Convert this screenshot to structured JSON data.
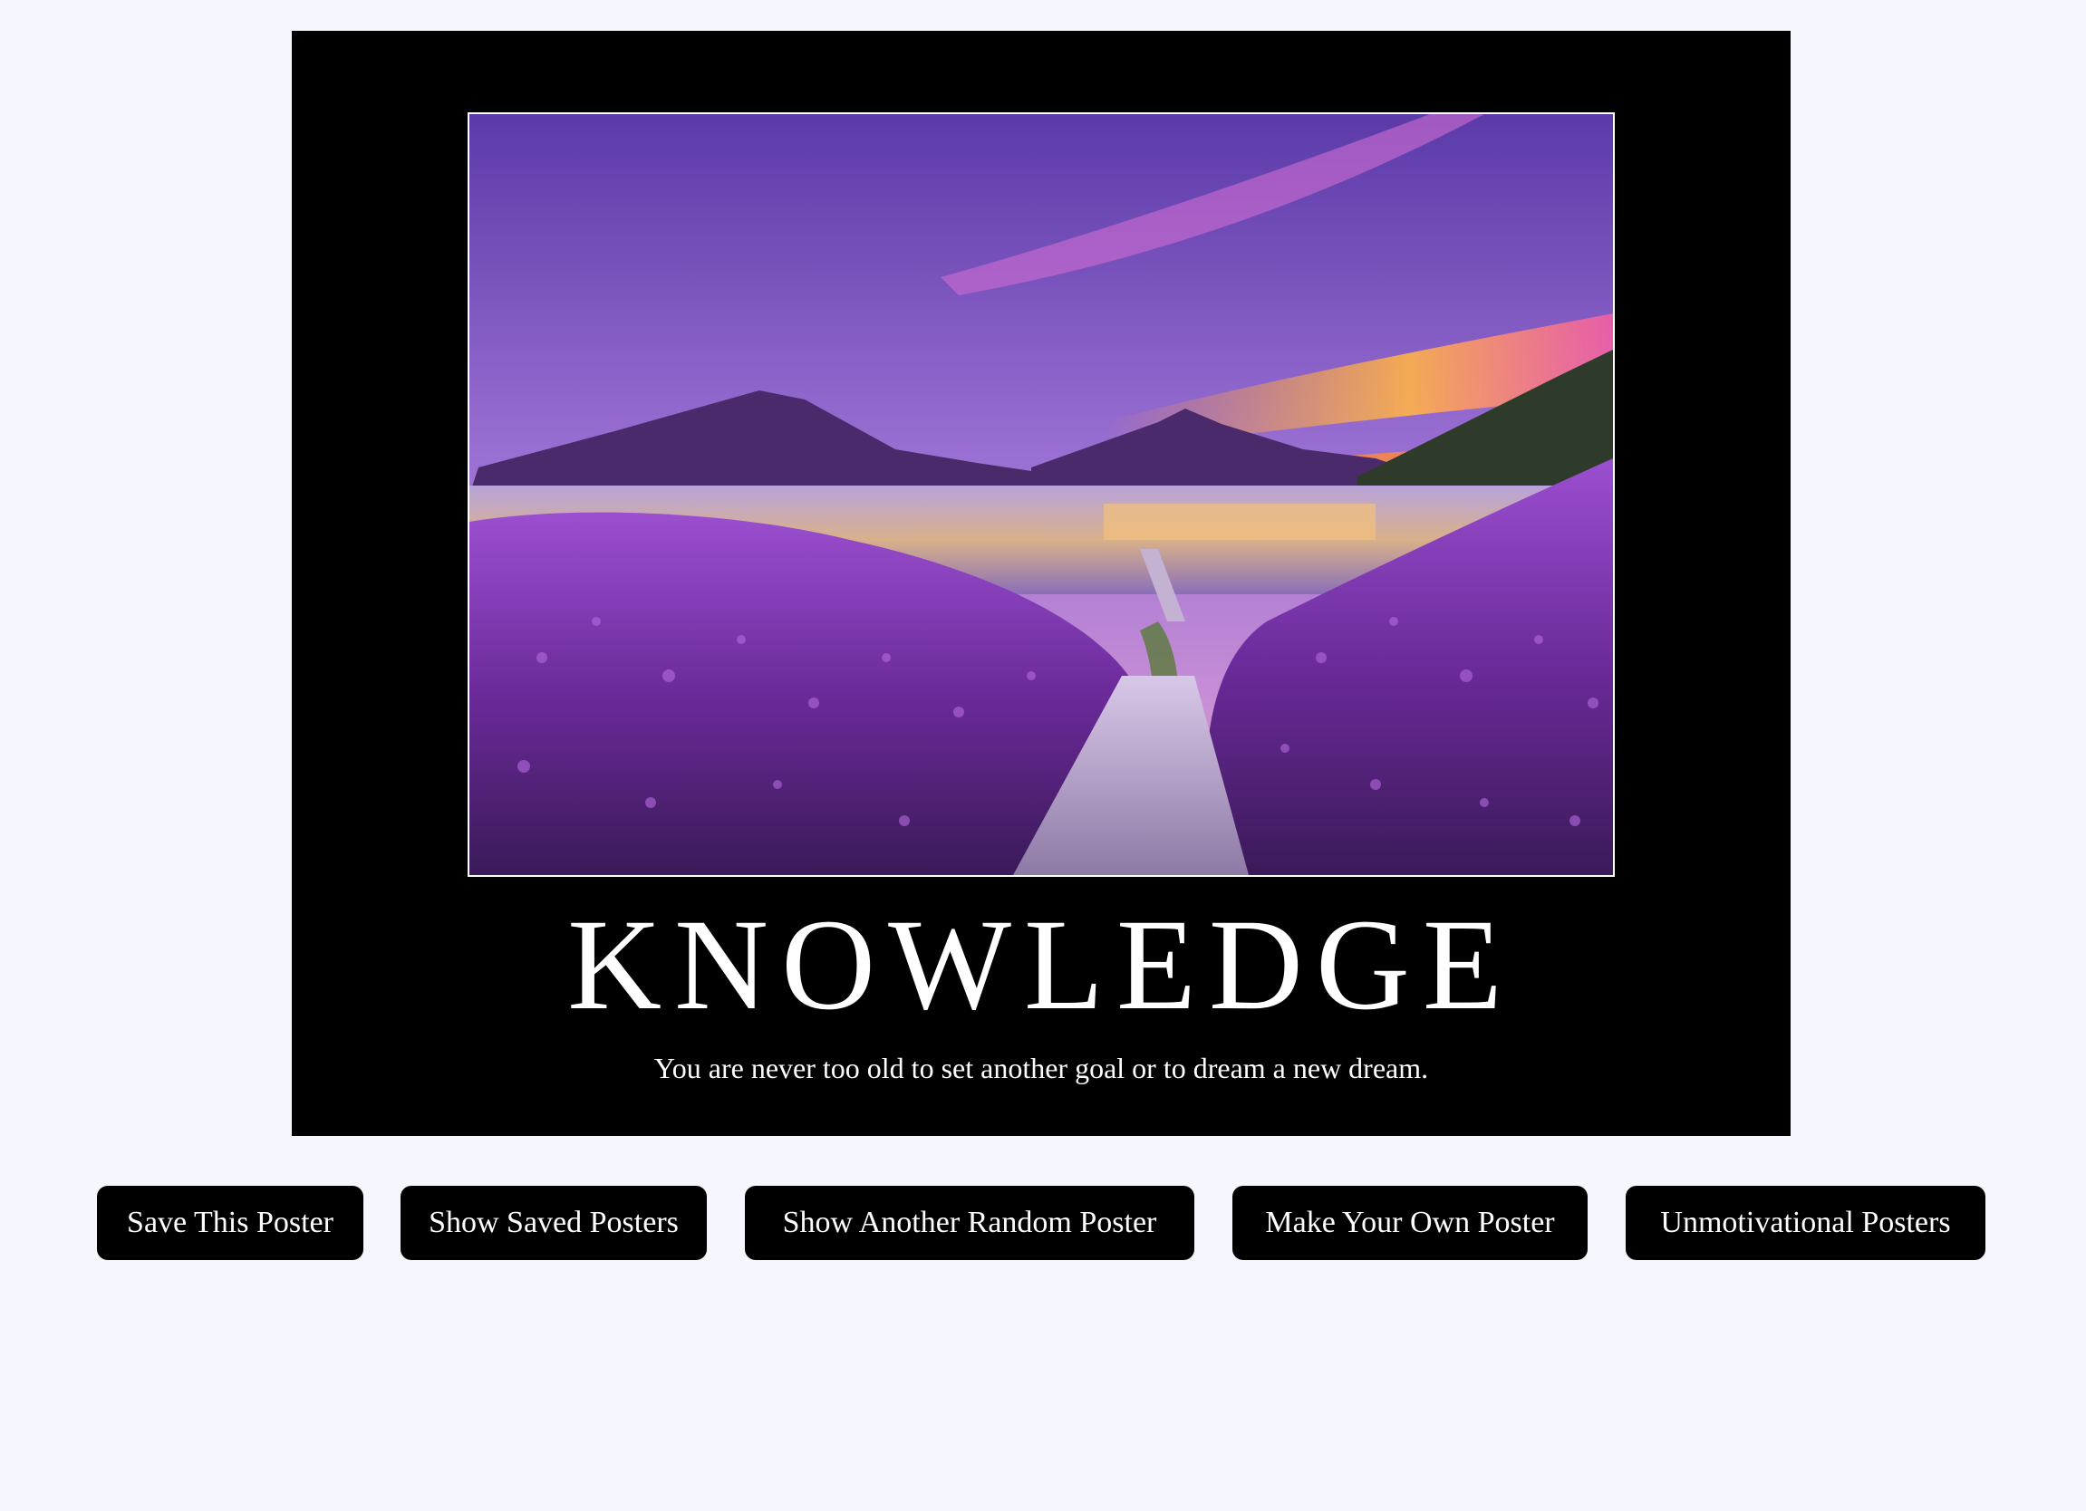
{
  "poster": {
    "title": "KNOWLEDGE",
    "quote": "You are never too old to set another goal or to dream a new dream.",
    "image_subject": "lake-with-volcanoes-and-purple-flowers-at-sunset"
  },
  "buttons": {
    "save": "Save This Poster",
    "show_saved": "Show Saved Posters",
    "random": "Show Another Random Poster",
    "make_own": "Make Your Own Poster",
    "unmotivational": "Unmotivational Posters"
  },
  "colors": {
    "page_background": "#f6f6fe",
    "poster_background": "#000000",
    "button_background": "#000000",
    "button_text": "#ffffff"
  }
}
